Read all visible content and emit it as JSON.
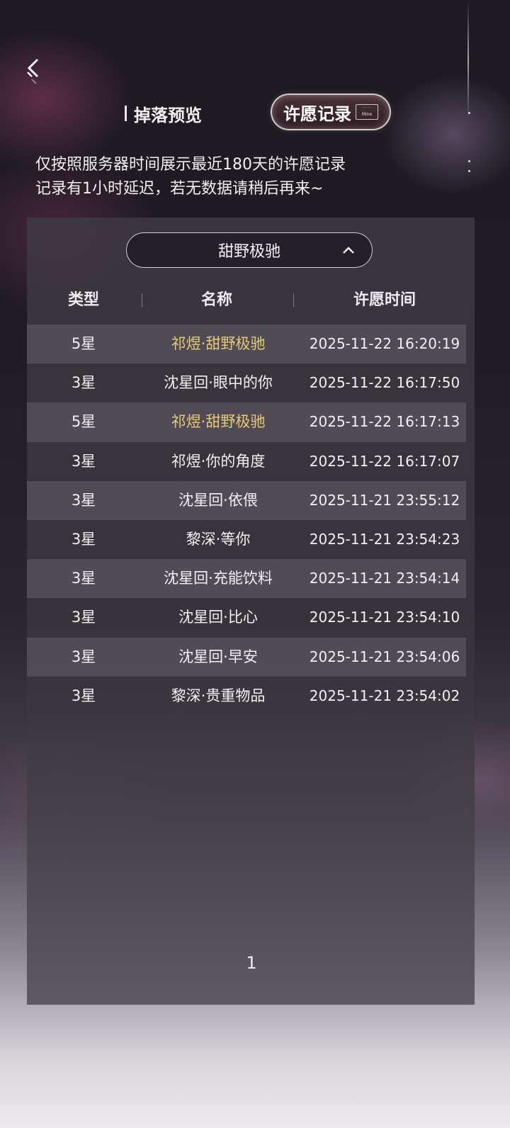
{
  "tabs": [
    {
      "label": "掉落预览",
      "active": false
    },
    {
      "label": "许愿记录",
      "active": true,
      "badge": "Mine"
    }
  ],
  "notice": {
    "line1": "仅按照服务器时间展示最近180天的许愿记录",
    "line2": "记录有1小时延迟，若无数据请稍后再来~"
  },
  "pool_select": {
    "value": "甜野极驰",
    "expanded": true
  },
  "table": {
    "headers": {
      "type": "类型",
      "name": "名称",
      "time": "许愿时间"
    },
    "rows": [
      {
        "type": "5星",
        "name": "祁煜·甜野极驰",
        "time": "2025-11-22 16:20:19",
        "highlight": true
      },
      {
        "type": "3星",
        "name": "沈星回·眼中的你",
        "time": "2025-11-22 16:17:50",
        "highlight": false
      },
      {
        "type": "5星",
        "name": "祁煜·甜野极驰",
        "time": "2025-11-22 16:17:13",
        "highlight": true
      },
      {
        "type": "3星",
        "name": "祁煜·你的角度",
        "time": "2025-11-22 16:17:07",
        "highlight": false
      },
      {
        "type": "3星",
        "name": "沈星回·依偎",
        "time": "2025-11-21 23:55:12",
        "highlight": false
      },
      {
        "type": "3星",
        "name": "黎深·等你",
        "time": "2025-11-21 23:54:23",
        "highlight": false
      },
      {
        "type": "3星",
        "name": "沈星回·充能饮料",
        "time": "2025-11-21 23:54:14",
        "highlight": false
      },
      {
        "type": "3星",
        "name": "沈星回·比心",
        "time": "2025-11-21 23:54:10",
        "highlight": false
      },
      {
        "type": "3星",
        "name": "沈星回·早安",
        "time": "2025-11-21 23:54:06",
        "highlight": false
      },
      {
        "type": "3星",
        "name": "黎深·贵重物品",
        "time": "2025-11-21 23:54:02",
        "highlight": false
      }
    ]
  },
  "pagination": {
    "current": "1"
  },
  "colors": {
    "highlight": "#e6c877",
    "text": "#f3f0f4"
  },
  "icons": {
    "back": "back-arrow-icon",
    "chevron": "chevron-up-icon"
  }
}
